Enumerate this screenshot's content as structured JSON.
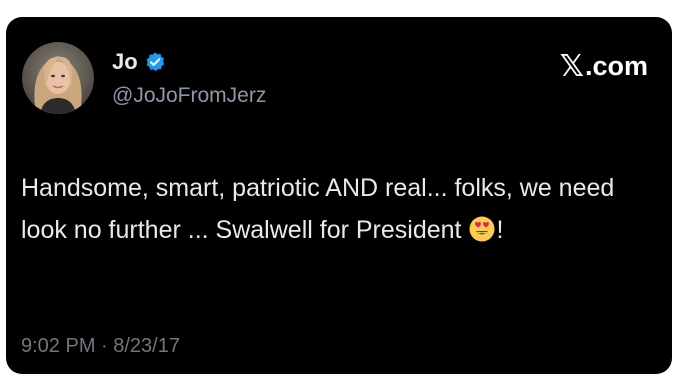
{
  "tweet": {
    "display_name": "Jo",
    "handle": "@JoJoFromJerz",
    "brand": ".com",
    "text_before_emoji": "Handsome, smart, patriotic AND real... folks, we need look no further ... Swalwell for President ",
    "text_after_emoji": "!",
    "emoji_name": "smiling-face-with-heart-eyes-emoji",
    "timestamp": "9:02 PM · 8/23/17"
  },
  "colors": {
    "background": "#000000",
    "text": "#e7e9ea",
    "secondary_text": "#8b98a5",
    "verified_badge": "#1d9bf0"
  },
  "icons": {
    "verified": "verified-badge-icon",
    "brand_logo": "x-logo-icon"
  }
}
